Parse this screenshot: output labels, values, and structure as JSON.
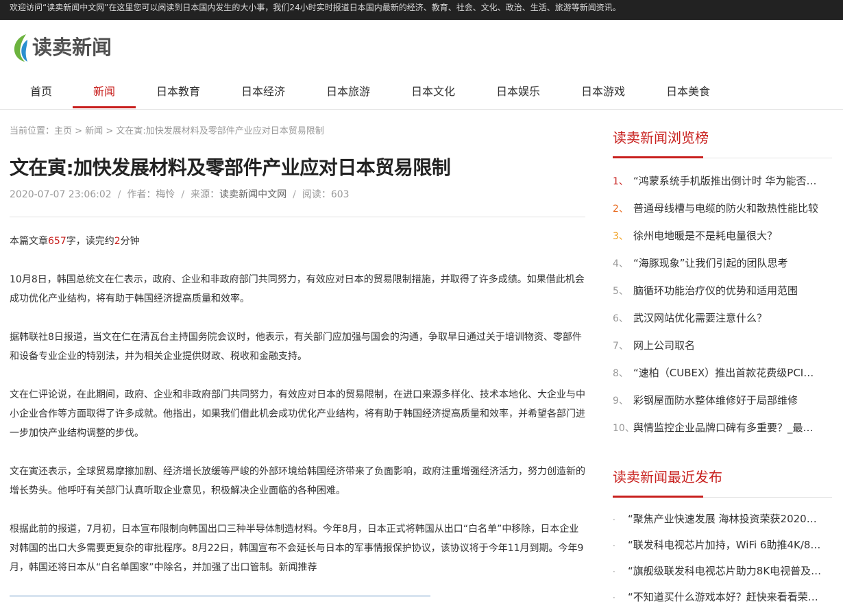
{
  "topbar": {
    "text": "欢迎访问“读卖新闻中文网”在这里您可以阅读到日本国内发生的大小事，我们24小时实时报道日本国内最新的经济、教育、社会、文化、政治、生活、旅游等新闻资讯。"
  },
  "logo": {
    "text": "读卖新闻"
  },
  "nav": {
    "items": [
      "首页",
      "新闻",
      "日本教育",
      "日本经济",
      "日本旅游",
      "日本文化",
      "日本娱乐",
      "日本游戏",
      "日本美食"
    ],
    "active_index": 1
  },
  "breadcrumb": {
    "prefix": "当前位置：",
    "home": "主页",
    "sep": " > ",
    "section": "新闻",
    "current": "文在寅:加快发展材料及零部件产业应对日本贸易限制"
  },
  "article": {
    "title": "文在寅:加快发展材料及零部件产业应对日本贸易限制",
    "date": "2020-07-07 23:06:02",
    "sep": "/",
    "author": "作者：梅怜",
    "source_label": "来源：",
    "source": "读卖新闻中文网",
    "reads": "阅读：603",
    "stats": {
      "a": "本篇文章",
      "words": "657",
      "b": "字，读完约",
      "minutes": "2",
      "c": "分钟"
    },
    "paragraphs": [
      "10月8日，韩国总统文在仁表示，政府、企业和非政府部门共同努力，有效应对日本的贸易限制措施，并取得了许多成绩。如果借此机会成功优化产业结构，将有助于韩国经济提高质量和效率。",
      "据韩联社8日报道，当文在仁在清瓦台主持国务院会议时，他表示，有关部门应加强与国会的沟通，争取早日通过关于培训物资、零部件和设备专业企业的特别法，并为相关企业提供财政、税收和金融支持。",
      "文在仁评论说，在此期间，政府、企业和非政府部门共同努力，有效应对日本的贸易限制，在进口来源多样化、技术本地化、大企业与中小企业合作等方面取得了许多成就。他指出，如果我们借此机会成功优化产业结构，将有助于韩国经济提高质量和效率，并希望各部门进一步加快产业结构调整的步伐。",
      "文在寅还表示，全球贸易摩擦加剧、经济增长放缓等严峻的外部环境给韩国经济带来了负面影响，政府注重增强经济活力，努力创造新的增长势头。他呼吁有关部门认真听取企业意见，积极解决企业面临的各种困难。",
      "根据此前的报道，7月初，日本宣布限制向韩国出口三种半导体制造材料。今年8月，日本正式将韩国从出口“白名单”中移除，日本企业对韩国的出口大多需要更复杂的审批程序。8月22日，韩国宣布不会延长与日本的军事情报保护协议，该协议将于今年11月到期。今年9月，韩国还将日本从“白名单国家”中除名，并加强了出口管制。新闻推荐"
    ]
  },
  "sidebar": {
    "ranking": {
      "heading": "读卖新闻浏览榜",
      "items": [
        {
          "num": "1、",
          "title": "“鸿蒙系统手机版推出倒计时 华为能否…"
        },
        {
          "num": "2、",
          "title": "普通母线槽与电缆的防火和散热性能比较"
        },
        {
          "num": "3、",
          "title": "徐州电地暖是不是耗电量很大？"
        },
        {
          "num": "4、",
          "title": "“海豚现象”让我们引起的团队思考"
        },
        {
          "num": "5、",
          "title": "脑循环功能治疗仪的优势和适用范围"
        },
        {
          "num": "6、",
          "title": "武汉网站优化需要注意什么？"
        },
        {
          "num": "7、",
          "title": "网上公司取名"
        },
        {
          "num": "8、",
          "title": "“速柏（CUBEX）推出首款花费级PCI…"
        },
        {
          "num": "9、",
          "title": "彩钢屋面防水整体维修好于局部维修"
        },
        {
          "num": "10、",
          "title": "舆情监控企业品牌口碑有多重要？_最…"
        }
      ]
    },
    "recent": {
      "heading": "读卖新闻最近发布",
      "bullet": "·",
      "items": [
        "“聚焦产业快速发展 海林投资荣获2020…",
        "“联发科电视芯片加持，WiFi 6助推4K/8…",
        "“旗舰级联发科电视芯片助力8K电视普及…",
        "“不知道买什么游戏本好？赶快来看看荣…"
      ]
    }
  },
  "colors": {
    "accent": "#c8201e",
    "topbar_bg": "#222222",
    "rank2": "#e86a1f",
    "rank3": "#f0a020"
  }
}
